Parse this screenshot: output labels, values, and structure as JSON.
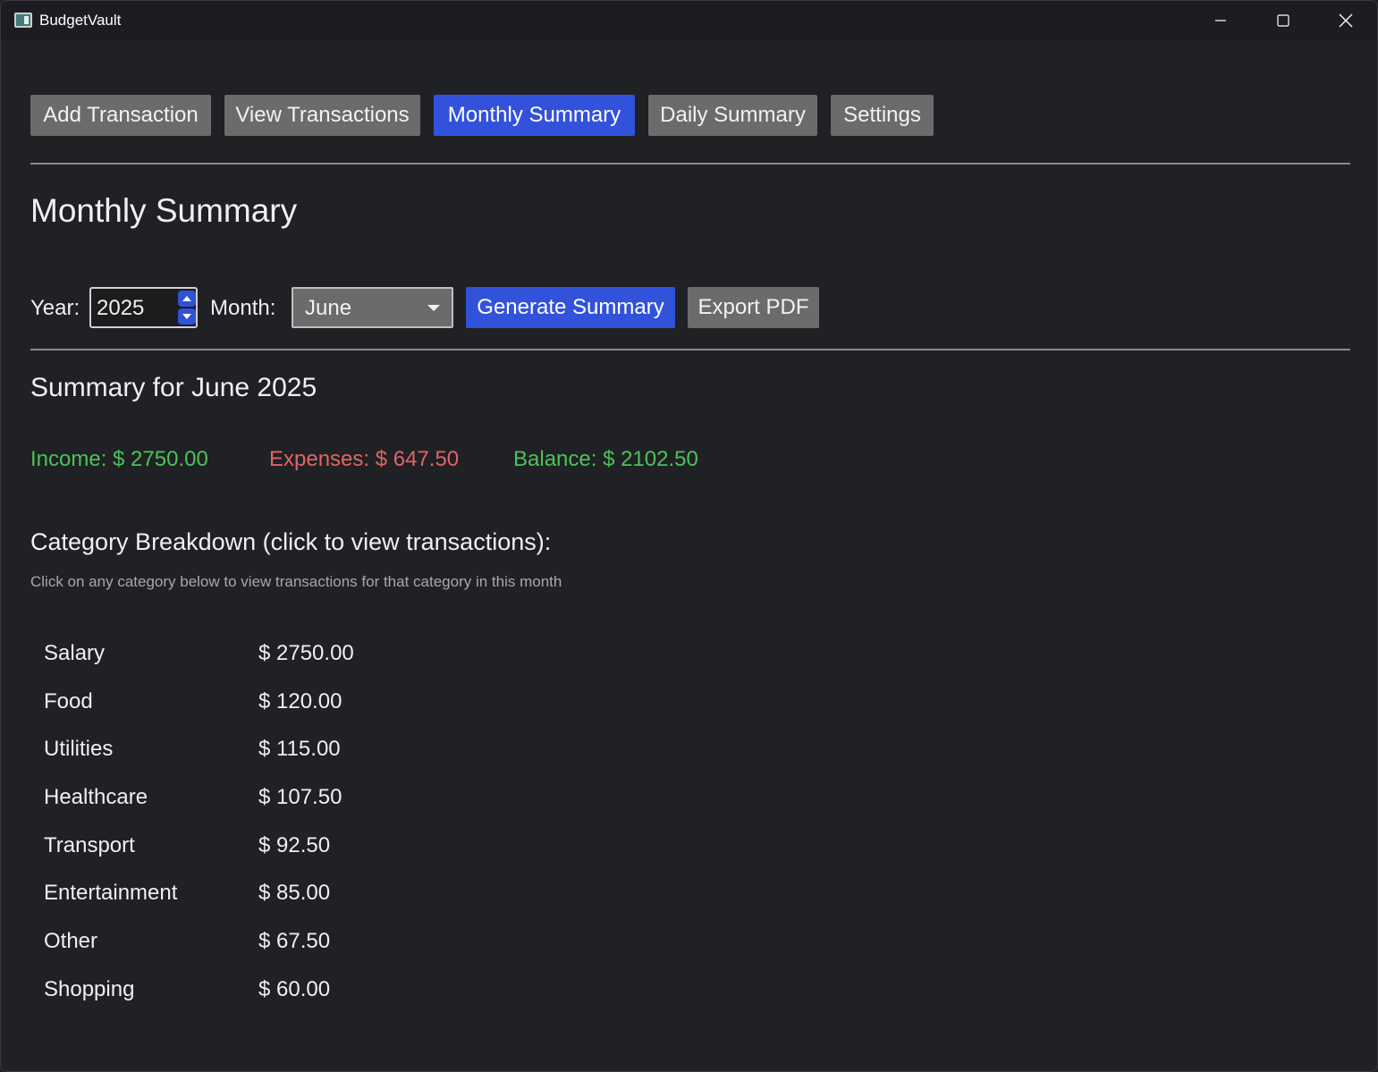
{
  "window": {
    "title": "BudgetVault"
  },
  "nav": {
    "items": [
      {
        "label": "Add Transaction"
      },
      {
        "label": "View Transactions"
      },
      {
        "label": "Monthly Summary"
      },
      {
        "label": "Daily Summary"
      },
      {
        "label": "Settings"
      }
    ],
    "active": "Monthly Summary"
  },
  "page": {
    "title": "Monthly Summary"
  },
  "controls": {
    "year_label": "Year:",
    "year_value": "2025",
    "month_label": "Month:",
    "month_value": "June",
    "generate_label": "Generate Summary",
    "export_label": "Export PDF"
  },
  "summary": {
    "heading": "Summary for June 2025",
    "income": "Income: $ 2750.00",
    "expenses": "Expenses: $ 647.50",
    "balance": "Balance: $ 2102.50"
  },
  "breakdown": {
    "heading": "Category Breakdown (click to view transactions):",
    "hint": "Click on any category below to view transactions for that category in this month",
    "categories": [
      {
        "name": "Salary",
        "amount": "$ 2750.00"
      },
      {
        "name": "Food",
        "amount": "$ 120.00"
      },
      {
        "name": "Utilities",
        "amount": "$ 115.00"
      },
      {
        "name": "Healthcare",
        "amount": "$ 107.50"
      },
      {
        "name": "Transport",
        "amount": "$ 92.50"
      },
      {
        "name": "Entertainment",
        "amount": "$ 85.00"
      },
      {
        "name": "Other",
        "amount": "$ 67.50"
      },
      {
        "name": "Shopping",
        "amount": "$ 60.00"
      }
    ]
  },
  "colors": {
    "background": "#202124",
    "accent": "#3252dc",
    "button_gray": "#6b6b6b",
    "income_green": "#4cc25a",
    "expense_red": "#e06565"
  }
}
